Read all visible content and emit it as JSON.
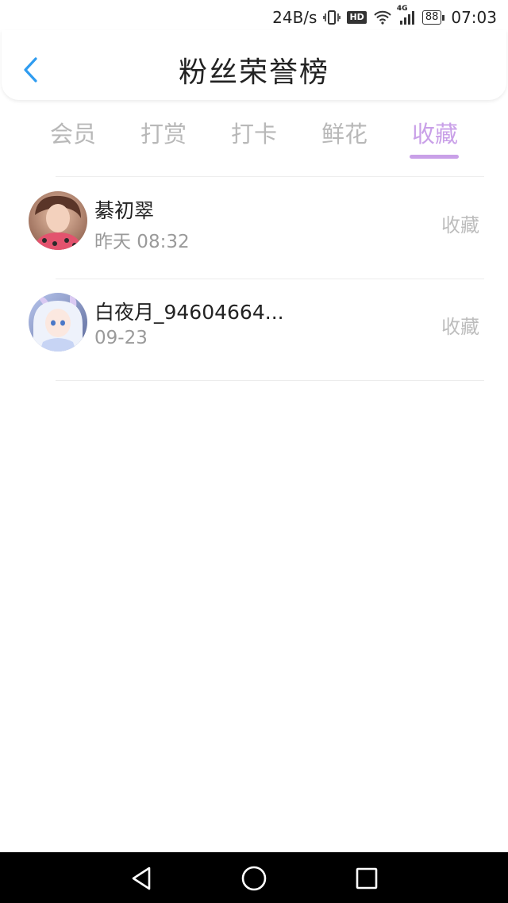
{
  "status_bar": {
    "speed": "24B/s",
    "hd_label": "HD",
    "network_label": "4G",
    "battery": "88",
    "time": "07:03"
  },
  "header": {
    "title": "粉丝荣誉榜"
  },
  "tabs": [
    {
      "label": "会员",
      "active": false
    },
    {
      "label": "打赏",
      "active": false
    },
    {
      "label": "打卡",
      "active": false
    },
    {
      "label": "鲜花",
      "active": false
    },
    {
      "label": "收藏",
      "active": true
    }
  ],
  "colors": {
    "accent": "#c9a0e8",
    "back_arrow": "#2f9cf0"
  },
  "fans": [
    {
      "name": "綦初翠",
      "time": "昨天 08:32",
      "action": "收藏"
    },
    {
      "name": "白夜月_94604664...",
      "time": "09-23",
      "action": "收藏"
    }
  ]
}
